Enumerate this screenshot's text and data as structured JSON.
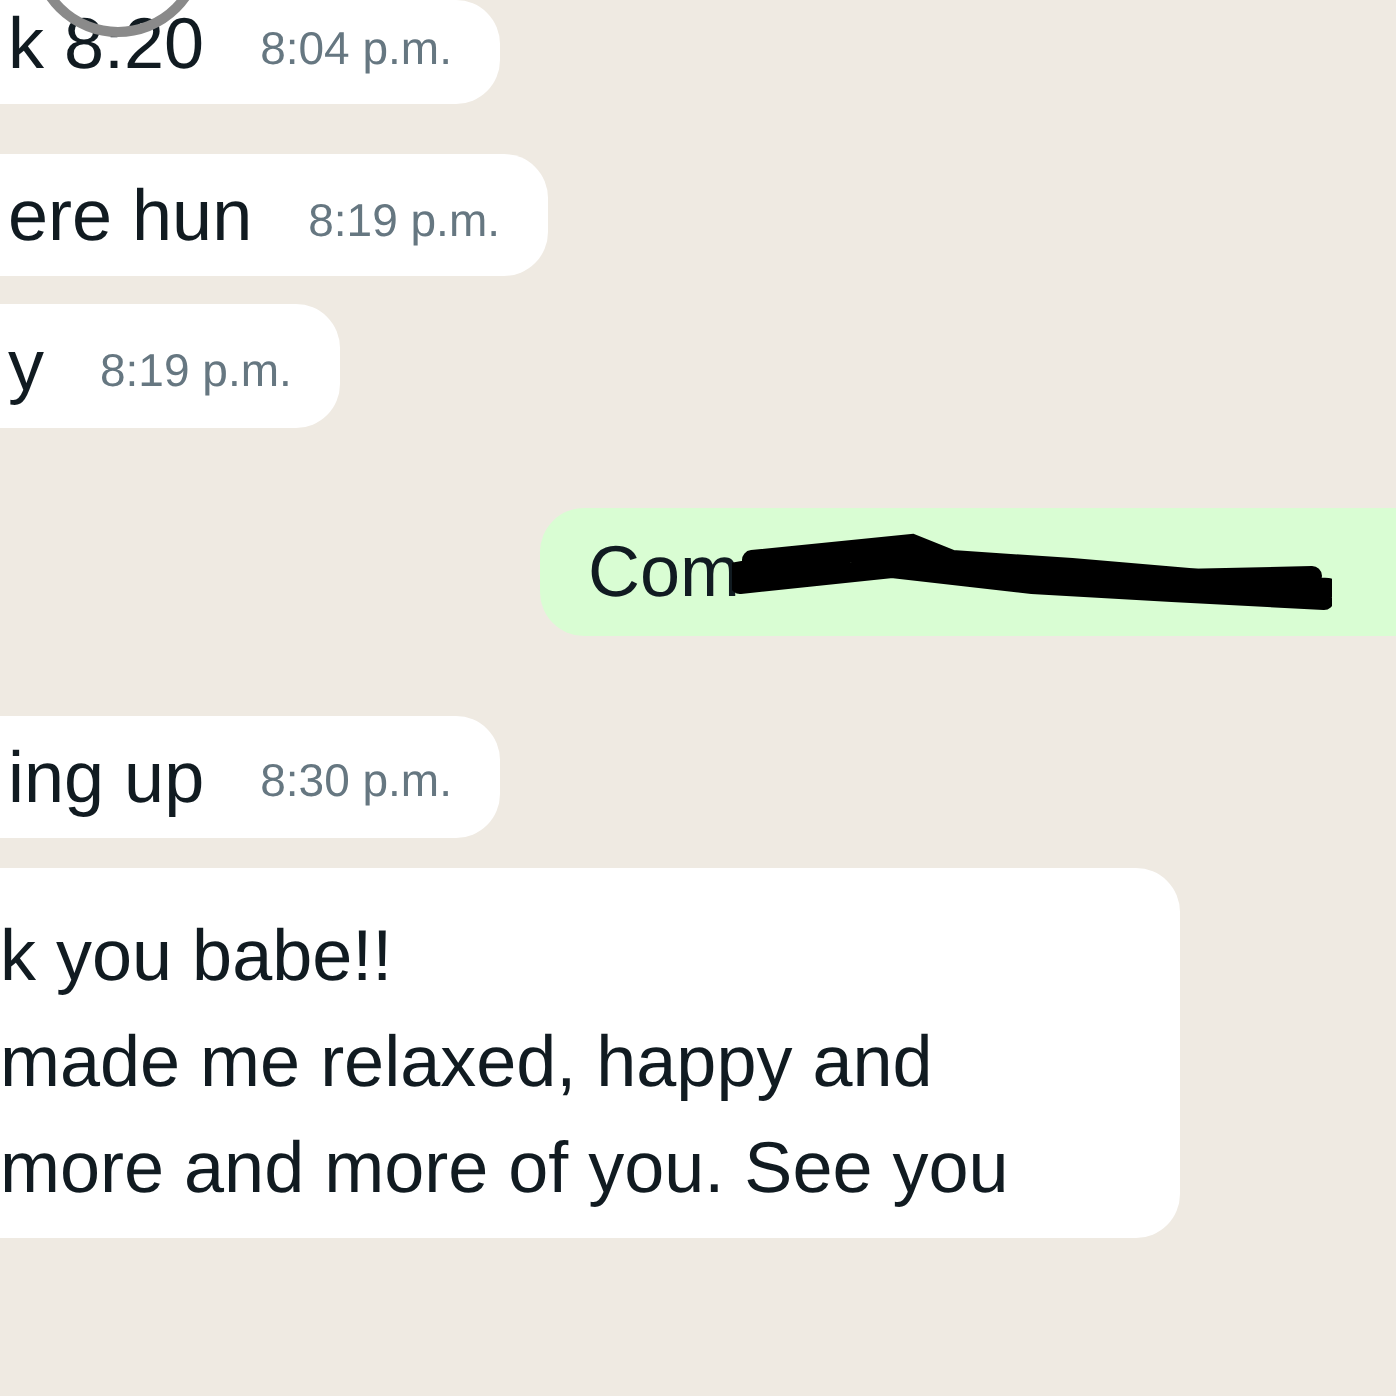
{
  "messages": [
    {
      "kind": "incoming",
      "text": "k 8:20",
      "time": "8:04 p.m."
    },
    {
      "kind": "incoming",
      "text": "ere hun",
      "time": "8:19 p.m."
    },
    {
      "kind": "incoming",
      "text": "y",
      "time": "8:19 p.m."
    },
    {
      "kind": "outgoing",
      "text": "Com",
      "redacted": true
    },
    {
      "kind": "incoming",
      "text": "ing up",
      "time": "8:30 p.m."
    },
    {
      "kind": "incoming",
      "text": "k you babe!!\nmade me relaxed, happy and\nmore and more of you. See you"
    }
  ]
}
